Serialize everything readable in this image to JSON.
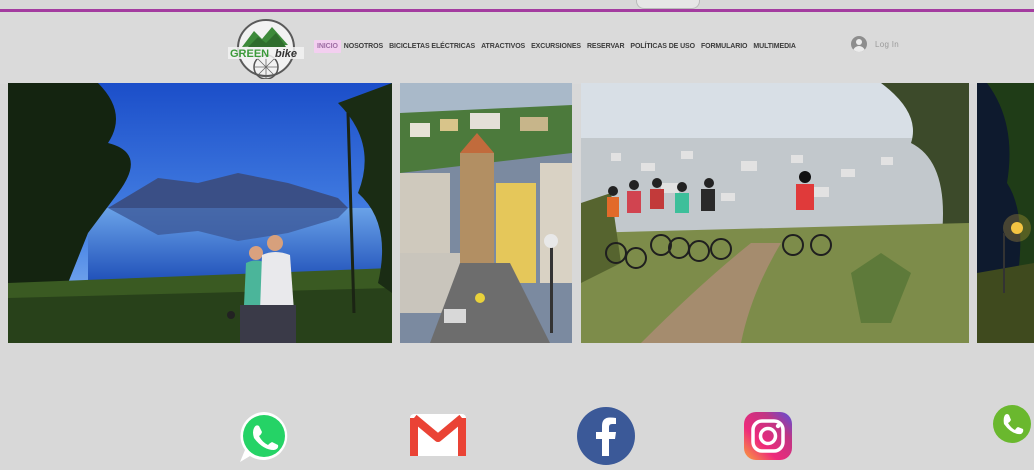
{
  "header": {
    "logo_text_green": "GREEN",
    "logo_text_bike": "bike",
    "nav": [
      {
        "label": "INICIO",
        "active": true
      },
      {
        "label": "NOSOTROS"
      },
      {
        "label": "BICICLETAS ELÉCTRICAS"
      },
      {
        "label": "ATRACTIVOS"
      },
      {
        "label": "EXCURSIONES"
      },
      {
        "label": "RESERVAR"
      },
      {
        "label": "POLÍTICAS DE USO"
      },
      {
        "label": "FORMULARIO"
      },
      {
        "label": "MULTIMEDIA"
      }
    ],
    "login_label": "Log In"
  },
  "gallery": {
    "photos": [
      {
        "name": "lake-couple-photo"
      },
      {
        "name": "town-street-photo"
      },
      {
        "name": "group-cyclists-photo"
      },
      {
        "name": "night-park-photo"
      }
    ]
  },
  "social": [
    {
      "name": "whatsapp-icon",
      "color": "#25D366"
    },
    {
      "name": "gmail-icon",
      "color": "#EA4335"
    },
    {
      "name": "facebook-icon",
      "color": "#3b5998"
    },
    {
      "name": "instagram-icon",
      "color": "#C13584"
    },
    {
      "name": "phone-icon",
      "color": "#6ab82e"
    }
  ]
}
